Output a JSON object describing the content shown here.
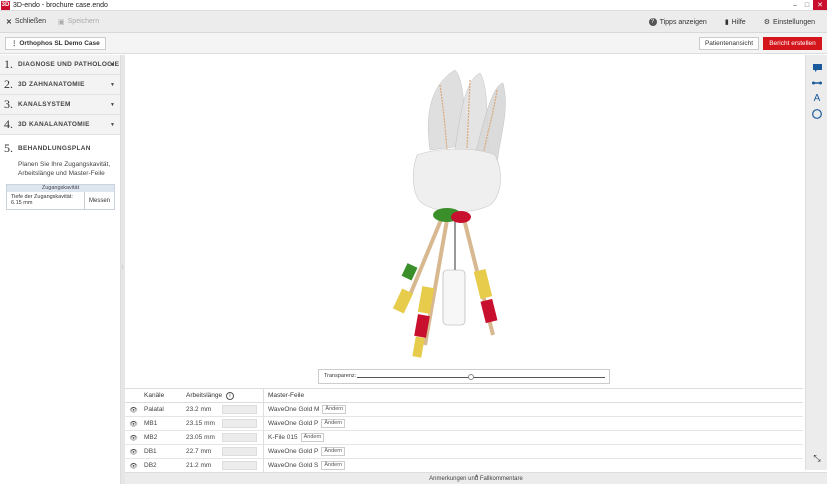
{
  "window": {
    "title": "3D-endo - brochure case.endo"
  },
  "toolbar": {
    "close_label": "Schließen",
    "save_label": "Speichern",
    "tips_label": "Tipps anzeigen",
    "help_label": "Hilfe",
    "settings_label": "Einstellungen"
  },
  "casebar": {
    "case_label": "Orthophos SL Demo Case",
    "patient_view_label": "Patientenansicht",
    "report_label": "Bericht erstellen"
  },
  "sidebar": {
    "steps": [
      {
        "num": "1.",
        "label": "DIAGNOSE UND PATHOLOGIE"
      },
      {
        "num": "2.",
        "label": "3D ZAHNANATOMIE"
      },
      {
        "num": "3.",
        "label": "KANALSYSTEM"
      },
      {
        "num": "4.",
        "label": "3D KANALANATOMIE"
      },
      {
        "num": "5.",
        "label": "BEHANDLUNGSPLAN",
        "description": "Planen Sie Ihre Zugangskavität, Arbeitslänge und Master-Feile"
      }
    ],
    "access_cavity": {
      "title": "Zugangskavität",
      "depth_label": "Tiefe der Zugangskavität: 6.15 mm",
      "measure_label": "Messen"
    }
  },
  "viewport": {
    "transparency_label": "Transparenz:",
    "transparency_value": 0.46
  },
  "table": {
    "headers": {
      "canals": "Kanäle",
      "length": "Arbeitslänge",
      "file": "Master-Feile"
    },
    "change_label": "Ändern",
    "rows": [
      {
        "canal": "Palatal",
        "length": "23.2 mm",
        "file": "WaveOne Gold M"
      },
      {
        "canal": "MB1",
        "length": "23.15 mm",
        "file": "WaveOne Gold P"
      },
      {
        "canal": "MB2",
        "length": "23.05 mm",
        "file": "K-File 015"
      },
      {
        "canal": "DB1",
        "length": "22.7 mm",
        "file": "WaveOne Gold P"
      },
      {
        "canal": "DB2",
        "length": "21.2 mm",
        "file": "WaveOne Gold S"
      }
    ]
  },
  "footer": {
    "label": "Anmerkungen und Fallkommentare"
  },
  "colors": {
    "accent": "#d4161c",
    "file_green": "#3b8f2b",
    "file_red": "#c8102e",
    "file_yellow": "#e6cc4a"
  }
}
